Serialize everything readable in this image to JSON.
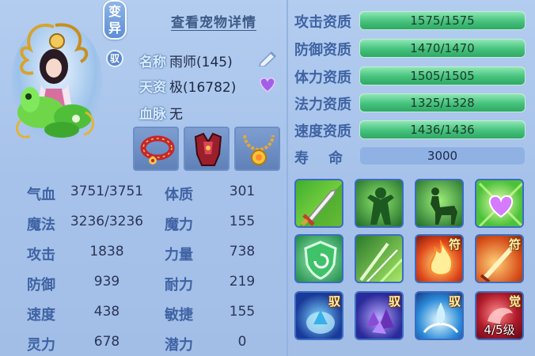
{
  "pet": {
    "tag_bianyi": "变异",
    "tag_yu": "驭",
    "detail_link": "查看宠物详情",
    "name_label": "名称",
    "name_value": "雨师(145)",
    "talent_label": "天资",
    "talent_value": "极(16782)",
    "blood_label": "血脉",
    "blood_value": "无"
  },
  "equipment": [
    {
      "name": "collar",
      "icon": "red-collar-icon"
    },
    {
      "name": "armor",
      "icon": "red-armor-icon"
    },
    {
      "name": "necklace",
      "icon": "gold-necklace-icon"
    }
  ],
  "stats": [
    {
      "label": "气血",
      "value": "3751/3751",
      "label2": "体质",
      "value2": "301"
    },
    {
      "label": "魔法",
      "value": "3236/3236",
      "label2": "魔力",
      "value2": "155"
    },
    {
      "label": "攻击",
      "value": "1838",
      "label2": "力量",
      "value2": "738"
    },
    {
      "label": "防御",
      "value": "939",
      "label2": "耐力",
      "value2": "219"
    },
    {
      "label": "速度",
      "value": "438",
      "label2": "敏捷",
      "value2": "155"
    },
    {
      "label": "灵力",
      "value": "678",
      "label2": "潜力",
      "value2": "0"
    }
  ],
  "aptitudes": [
    {
      "label": "攻击资质",
      "value": "1575/1575",
      "fill": 1.0
    },
    {
      "label": "防御资质",
      "value": "1470/1470",
      "fill": 1.0
    },
    {
      "label": "体力资质",
      "value": "1505/1505",
      "fill": 1.0
    },
    {
      "label": "法力资质",
      "value": "1325/1328",
      "fill": 0.998
    },
    {
      "label": "速度资质",
      "value": "1436/1436",
      "fill": 1.0
    }
  ],
  "lifespan": {
    "label": "寿    命",
    "value": "3000"
  },
  "skills": [
    {
      "icon": "sword-strike-icon",
      "badge": ""
    },
    {
      "icon": "green-figure-icon",
      "badge": ""
    },
    {
      "icon": "centaur-icon",
      "badge": ""
    },
    {
      "icon": "heart-burst-icon",
      "badge": ""
    },
    {
      "icon": "shield-swirl-icon",
      "badge": ""
    },
    {
      "icon": "green-slash-icon",
      "badge": ""
    },
    {
      "icon": "flame-icon",
      "badge": "符"
    },
    {
      "icon": "fire-sword-icon",
      "badge": "符"
    },
    {
      "icon": "ice-spirit-icon",
      "badge": "驭"
    },
    {
      "icon": "purple-crystal-icon",
      "badge": "驭"
    },
    {
      "icon": "water-splash-icon",
      "badge": "驭"
    },
    {
      "icon": "red-awaken-icon",
      "badge": "觉",
      "level": "4/5级"
    }
  ],
  "colors": {
    "background": "#a9c4ea",
    "label_blue": "#3f63a3",
    "bar_green": "#45c27c",
    "skill_border": "#3c6cc0"
  }
}
